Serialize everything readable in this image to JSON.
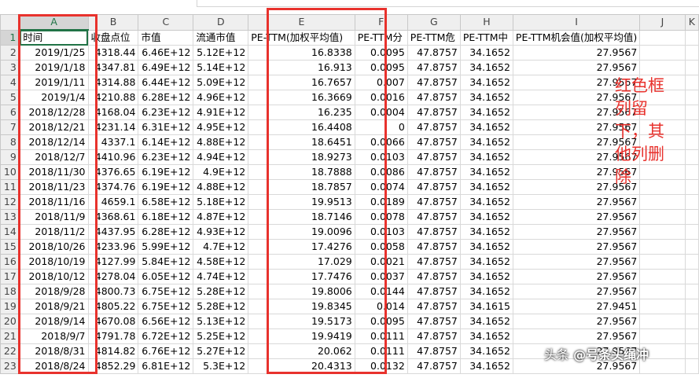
{
  "columns": [
    "A",
    "B",
    "C",
    "D",
    "E",
    "F",
    "G",
    "H",
    "I",
    "J",
    "K"
  ],
  "headers": [
    "时间",
    "收盘点位",
    "市值",
    "流通市值",
    "PE-TTM(加权平均值)",
    "PE-TTM分",
    "PE-TTM危",
    "PE-TTM中",
    "PE-TTM机会值(加权平均值)",
    "",
    ""
  ],
  "rows": [
    [
      "2019/1/25",
      "4318.44",
      "6.46E+12",
      "5.12E+12",
      "16.8338",
      "0.0095",
      "47.8757",
      "34.1652",
      "27.9567"
    ],
    [
      "2019/1/18",
      "4347.81",
      "6.49E+12",
      "5.14E+12",
      "16.913",
      "0.0095",
      "47.8757",
      "34.1652",
      "27.9567"
    ],
    [
      "2019/1/11",
      "4314.88",
      "6.44E+12",
      "5.09E+12",
      "16.7657",
      "0.007",
      "47.8757",
      "34.1652",
      "27.9567"
    ],
    [
      "2019/1/4",
      "4210.88",
      "6.28E+12",
      "4.96E+12",
      "16.3669",
      "0.0016",
      "47.8757",
      "34.1652",
      "27.9567"
    ],
    [
      "2018/12/28",
      "4168.04",
      "6.23E+12",
      "4.91E+12",
      "16.235",
      "0.0004",
      "47.8757",
      "34.1652",
      "27.9567"
    ],
    [
      "2018/12/21",
      "4231.14",
      "6.31E+12",
      "4.95E+12",
      "16.4408",
      "0",
      "47.8757",
      "34.1652",
      "27.9567"
    ],
    [
      "2018/12/14",
      "4337.1",
      "6.14E+12",
      "4.88E+12",
      "18.6451",
      "0.0066",
      "47.8757",
      "34.1652",
      "27.9567"
    ],
    [
      "2018/12/7",
      "4410.96",
      "6.23E+12",
      "4.94E+12",
      "18.9273",
      "0.0103",
      "47.8757",
      "34.1652",
      "27.9567"
    ],
    [
      "2018/11/30",
      "4376.65",
      "6.19E+12",
      "4.9E+12",
      "18.7888",
      "0.0086",
      "47.8757",
      "34.1652",
      "27.9567"
    ],
    [
      "2018/11/23",
      "4374.76",
      "6.19E+12",
      "4.88E+12",
      "18.7857",
      "0.0074",
      "47.8757",
      "34.1652",
      "27.9567"
    ],
    [
      "2018/11/16",
      "4659.1",
      "6.58E+12",
      "5.18E+12",
      "19.9513",
      "0.0189",
      "47.8757",
      "34.1652",
      "27.9567"
    ],
    [
      "2018/11/9",
      "4368.61",
      "6.18E+12",
      "4.87E+12",
      "18.7146",
      "0.0078",
      "47.8757",
      "34.1652",
      "27.9567"
    ],
    [
      "2018/11/2",
      "4437.95",
      "6.28E+12",
      "4.93E+12",
      "19.0096",
      "0.0103",
      "47.8757",
      "34.1652",
      "27.9567"
    ],
    [
      "2018/10/26",
      "4233.96",
      "5.99E+12",
      "4.7E+12",
      "17.4276",
      "0.0058",
      "47.8757",
      "34.1652",
      "27.9567"
    ],
    [
      "2018/10/19",
      "4127.99",
      "5.84E+12",
      "4.58E+12",
      "17.029",
      "0.0021",
      "47.8757",
      "34.1652",
      "27.9567"
    ],
    [
      "2018/10/12",
      "4278.04",
      "6.05E+12",
      "4.74E+12",
      "17.7476",
      "0.0037",
      "47.8757",
      "34.1652",
      "27.9567"
    ],
    [
      "2018/9/28",
      "4800.73",
      "6.75E+12",
      "5.28E+12",
      "19.8006",
      "0.0144",
      "47.8757",
      "34.1652",
      "27.9567"
    ],
    [
      "2018/9/21",
      "4805.22",
      "6.75E+12",
      "5.28E+12",
      "19.8345",
      "0.014",
      "47.8757",
      "34.1615",
      "27.9451"
    ],
    [
      "2018/9/14",
      "4670.08",
      "6.56E+12",
      "5.13E+12",
      "19.5173",
      "0.0095",
      "47.8757",
      "34.1652",
      "27.9567"
    ],
    [
      "2018/9/7",
      "4791.78",
      "6.72E+12",
      "5.25E+12",
      "19.9419",
      "0.0111",
      "47.8757",
      "34.1652",
      "27.9567"
    ],
    [
      "2018/8/31",
      "4814.82",
      "6.76E+12",
      "5.27E+12",
      "20.062",
      "0.0111",
      "47.8757",
      "34.1652",
      "27.9567"
    ],
    [
      "2018/8/24",
      "4852.29",
      "6.81E+12",
      "5.3E+12",
      "20.4313",
      "0.0132",
      "47.8757",
      "34.1652",
      "27.9567"
    ]
  ],
  "annotation": "红色框列留下，其他列删除",
  "watermark": {
    "prefix": "头条",
    "handle": "@号条头绳冲"
  },
  "colors": {
    "highlight": "#e8322d",
    "selection": "#217346"
  }
}
